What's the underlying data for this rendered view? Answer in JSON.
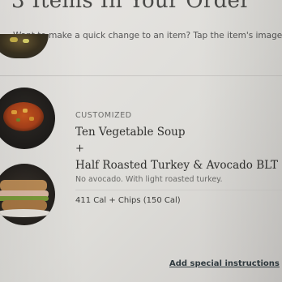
{
  "order": {
    "title": "3 Items In Your Order",
    "hint": "Want to make a quick change to an item? Tap the item's image to cus"
  },
  "item": {
    "tag": "CUSTOMIZED",
    "name_1": "Ten Vegetable Soup",
    "plus": "+",
    "name_2": "Half Roasted Turkey & Avocado BLT",
    "modifications": "No avocado. With light roasted turkey.",
    "calories": "411 Cal + Chips (150 Cal)"
  },
  "actions": {
    "special_instructions": "Add special instructions"
  }
}
